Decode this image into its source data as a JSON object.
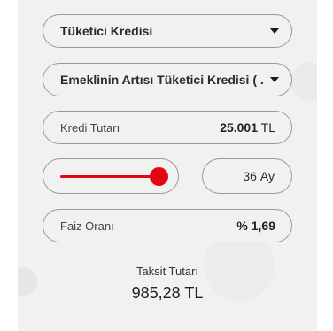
{
  "colors": {
    "accent": "#e30613",
    "panel_bg": "#f1f1f1",
    "border": "#9a9a9a"
  },
  "form": {
    "credit_type": {
      "selected": "Tüketici Kredisi",
      "icon": "caret-down-icon"
    },
    "credit_subtype": {
      "selected": "Emeklinin Artısı Tüketici Kredisi ( ...",
      "icon": "caret-down-icon"
    },
    "amount": {
      "label": "Kredi Tutarı",
      "value": "25.001",
      "currency": "TL"
    },
    "term": {
      "slider_position": 1.0,
      "value": "36",
      "unit": "Ay"
    },
    "interest": {
      "label": "Faiz Oranı",
      "value": "% 1,69"
    }
  },
  "result": {
    "label": "Taksit Tutarı",
    "value": "985,28 TL"
  }
}
